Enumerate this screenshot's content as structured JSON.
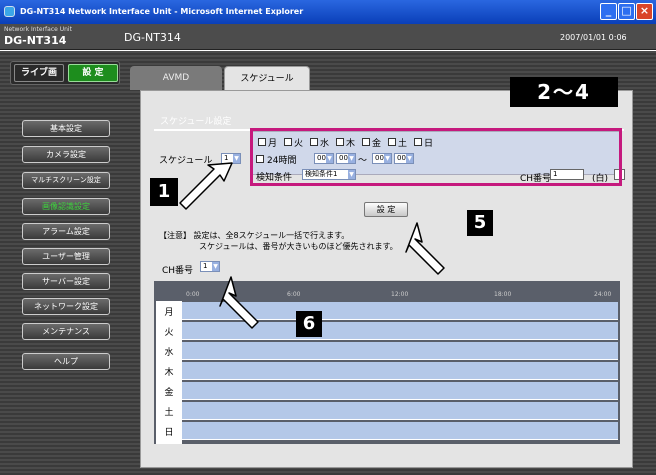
{
  "window": {
    "title": "DG-NT314 Network Interface Unit - Microsoft Internet Explorer"
  },
  "header": {
    "unit_small": "Network Interface Unit",
    "unit_large": "DG-NT314",
    "model": "DG-NT314",
    "datetime": "2007/01/01  0:06"
  },
  "mode": {
    "live": "ライブ画",
    "setting": "設 定"
  },
  "nav": [
    "基本設定",
    "カメラ設定",
    "マルチスクリーン設定",
    "画像認識設定",
    "アラーム設定",
    "ユーザー管理",
    "サーバー設定",
    "ネットワーク設定",
    "メンテナンス",
    "ヘルプ"
  ],
  "tabs": {
    "avmd": "AVMD",
    "schedule": "スケジュール"
  },
  "schedule": {
    "title": "スケジュール設定",
    "label": "スケジュール",
    "selected": "1",
    "days": [
      "月",
      "火",
      "水",
      "木",
      "金",
      "土",
      "日"
    ],
    "h24": "24時間",
    "time": {
      "h1": "00",
      "m1": "00",
      "sep": "〜",
      "h2": "00",
      "m2": "00"
    },
    "detect_label": "検知条件",
    "detect_value": "検知条件1",
    "ch_label": "CH番号",
    "ch_value": "1",
    "ch_unit": "(白)"
  },
  "set_button": "設 定",
  "note": {
    "line1": "【注意】 設定は、全8スケジュール一括で行えます。",
    "line2": "スケジュールは、番号が大きいものほど優先されます。"
  },
  "ch2": {
    "label": "CH番号",
    "value": "1"
  },
  "timeline": {
    "ticks": [
      "0:00",
      "6:00",
      "12:00",
      "18:00",
      "24:00"
    ],
    "days": [
      "月",
      "火",
      "水",
      "木",
      "金",
      "土",
      "日"
    ]
  },
  "callouts": {
    "c1": "1",
    "c24": "2〜4",
    "c5": "5",
    "c6": "6"
  },
  "colors": {
    "accent_box": "#c5197d",
    "active_nav": "#3fd23f",
    "setting_btn": "#1d8d1d",
    "timeline_row": "#b4c8e8"
  }
}
